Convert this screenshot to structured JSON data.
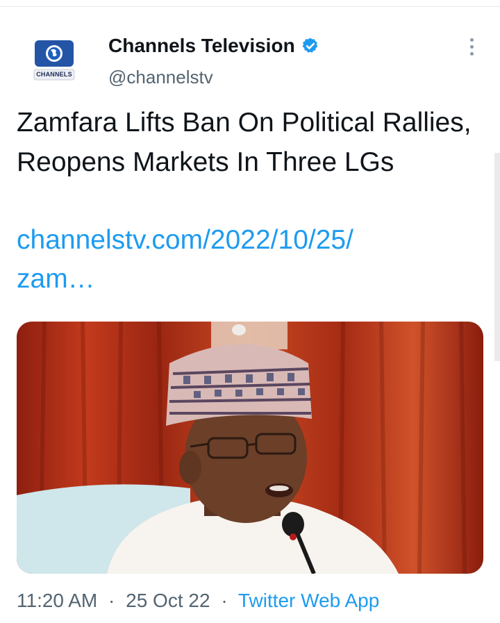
{
  "tweet": {
    "author": {
      "avatar_text": "CHANNELS",
      "display_name": "Channels Television",
      "handle": "@channelstv",
      "verified_icon": "verified-badge-icon"
    },
    "more_icon": "more-options-icon",
    "headline": "Zamfara Lifts Ban On Political Rallies, Reopens Markets In Three LGs",
    "link": {
      "line1": "channelstv.com/2022/10/25/",
      "line2": "zam…"
    },
    "media_alt_subject": "photo",
    "time": "11:20 AM",
    "date": "25 Oct 22",
    "separator": "·",
    "source": "Twitter Web App"
  },
  "colors": {
    "text_primary": "#0f1419",
    "text_secondary": "#536471",
    "link_blue": "#1d9bf0",
    "channels_blue": "#2454a6",
    "verified_blue": "#1d9bf0"
  }
}
